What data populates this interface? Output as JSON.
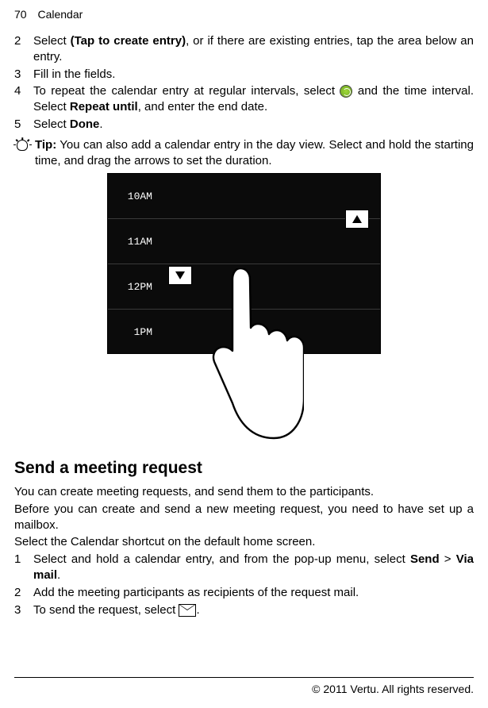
{
  "header": {
    "pagenum": "70",
    "section": "Calendar"
  },
  "steps_a": [
    {
      "num": "2",
      "segments": [
        "Select ",
        {
          "bold": "(Tap to create entry)"
        },
        ", or if there are existing entries, tap the area below an entry."
      ]
    },
    {
      "num": "3",
      "segments": [
        "Fill in the fields."
      ]
    },
    {
      "num": "4",
      "segments": [
        "To repeat the calendar entry at regular intervals, select ",
        {
          "icon": "repeat"
        },
        " and the time interval. Select ",
        {
          "bold": "Repeat until"
        },
        ", and enter the end date."
      ]
    },
    {
      "num": "5",
      "segments": [
        "Select ",
        {
          "bold": "Done"
        },
        "."
      ]
    }
  ],
  "tip": {
    "label": "Tip:",
    "text": " You can also add a calendar entry in the day view. Select and hold the starting time, and drag the arrows to set the duration."
  },
  "illustration": {
    "hours": [
      "10AM",
      "11AM",
      "12PM",
      "1PM"
    ]
  },
  "heading": "Send a meeting request",
  "para1": "You can create meeting requests, and send them to the participants.",
  "para2": "Before you can create and send a new meeting request, you need to have set up a mailbox.",
  "para3": "Select the Calendar shortcut on the default home screen.",
  "steps_b": [
    {
      "num": "1",
      "segments": [
        "Select and hold a calendar entry, and from the pop-up menu, select ",
        {
          "bold": "Send"
        },
        " > ",
        {
          "bold": "Via mail"
        },
        "."
      ]
    },
    {
      "num": "2",
      "segments": [
        "Add the meeting participants as recipients of the request mail."
      ]
    },
    {
      "num": "3",
      "segments": [
        "To send the request, select ",
        {
          "icon": "envelope"
        },
        "."
      ]
    }
  ],
  "footer": "© 2011 Vertu. All rights reserved."
}
